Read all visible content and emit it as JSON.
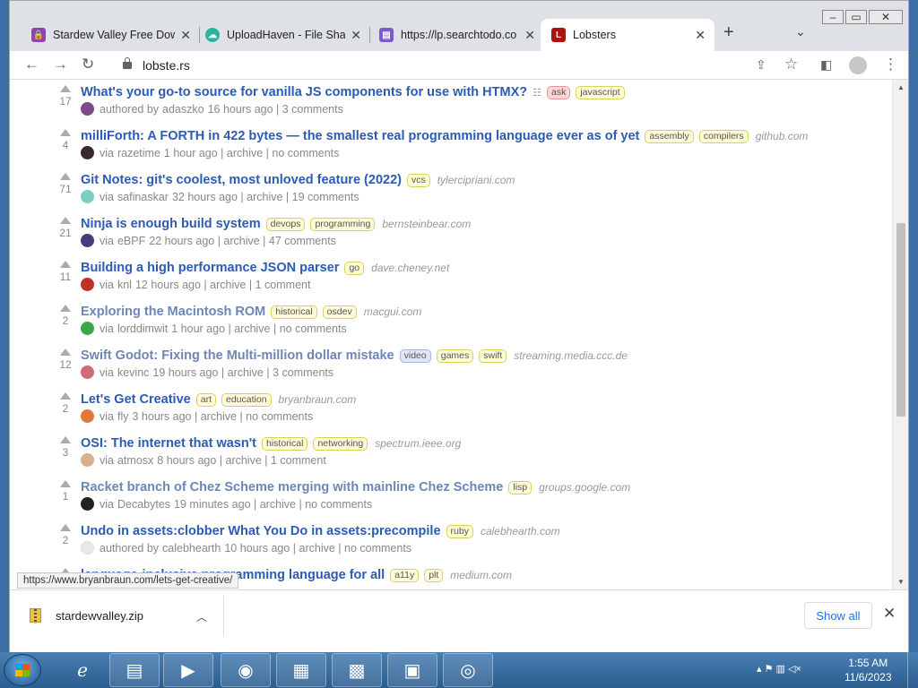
{
  "browser": {
    "tabs": [
      {
        "label": "Stardew Valley Free Dow",
        "active": false,
        "favicon_color": "#8e44ad"
      },
      {
        "label": "UploadHaven - File Shar",
        "active": false,
        "favicon_color": "#2bb39b"
      },
      {
        "label": "https://lp.searchtodo.co",
        "active": false,
        "favicon_color": "#7b5cc4"
      },
      {
        "label": "Lobsters",
        "active": true,
        "favicon_color": "#ac130d"
      }
    ],
    "favicon_letter": "L",
    "new_tab": "+",
    "address": "lobste.rs"
  },
  "stories": [
    {
      "title": "What's your go-to source for vanilla JS components for use with HTMX?",
      "score": "17",
      "tags": [
        "ask",
        "javascript"
      ],
      "domain": "",
      "byline": "authored by",
      "user": "adaszko",
      "meta": "16 hours ago | 3 comments",
      "visited": false,
      "avatar_color": "#7b4a8a"
    },
    {
      "title": "milliForth: A FORTH in 422 bytes — the smallest real programming language ever as of yet",
      "score": "4",
      "tags": [
        "assembly",
        "compilers"
      ],
      "domain": "github.com",
      "byline": "via",
      "user": "razetime",
      "meta": "1 hour ago | archive | no comments",
      "visited": false,
      "avatar_color": "#3a2a2a"
    },
    {
      "title": "Git Notes: git's coolest, most unloved feature (2022)",
      "score": "71",
      "tags": [
        "vcs"
      ],
      "domain": "tylercipriani.com",
      "byline": "via",
      "user": "safinaskar",
      "meta": "32 hours ago | archive | 19 comments",
      "visited": false,
      "avatar_color": "#7fcfc0"
    },
    {
      "title": "Ninja is enough build system",
      "score": "21",
      "tags": [
        "devops",
        "programming"
      ],
      "domain": "bernsteinbear.com",
      "byline": "via",
      "user": "eBPF",
      "meta": "22 hours ago | archive | 47 comments",
      "visited": false,
      "avatar_color": "#4a3a7a"
    },
    {
      "title": "Building a high performance JSON parser",
      "score": "11",
      "tags": [
        "go"
      ],
      "domain": "dave.cheney.net",
      "byline": "via",
      "user": "knl",
      "meta": "12 hours ago | archive | 1 comment",
      "visited": false,
      "avatar_color": "#c0302a"
    },
    {
      "title": "Exploring the Macintosh ROM",
      "score": "2",
      "tags": [
        "historical",
        "osdev"
      ],
      "domain": "macgui.com",
      "byline": "via",
      "user": "lorddimwit",
      "meta": "1 hour ago | archive | no comments",
      "visited": true,
      "avatar_color": "#3aa84a"
    },
    {
      "title": "Swift Godot: Fixing the Multi-million dollar mistake",
      "score": "12",
      "tags": [
        "video",
        "games",
        "swift"
      ],
      "domain": "streaming.media.ccc.de",
      "byline": "via",
      "user": "kevinc",
      "meta": "19 hours ago | archive | 3 comments",
      "visited": true,
      "avatar_color": "#d06a7a"
    },
    {
      "title": "Let's Get Creative",
      "score": "2",
      "tags": [
        "art",
        "education"
      ],
      "domain": "bryanbraun.com",
      "byline": "via",
      "user": "fly",
      "meta": "3 hours ago | archive | no comments",
      "visited": false,
      "avatar_color": "#e07a3a"
    },
    {
      "title": "OSI: The internet that wasn't",
      "score": "3",
      "tags": [
        "historical",
        "networking"
      ],
      "domain": "spectrum.ieee.org",
      "byline": "via",
      "user": "atmosx",
      "meta": "8 hours ago | archive | 1 comment",
      "visited": false,
      "avatar_color": "#d9b08a"
    },
    {
      "title": "Racket branch of Chez Scheme merging with mainline Chez Scheme",
      "score": "1",
      "tags": [
        "lisp"
      ],
      "domain": "groups.google.com",
      "byline": "via",
      "user": "Decabytes",
      "meta": "19 minutes ago | archive | no comments",
      "visited": true,
      "avatar_color": "#222222"
    },
    {
      "title": "Undo in assets:clobber What You Do in assets:precompile",
      "score": "2",
      "tags": [
        "ruby"
      ],
      "domain": "calebhearth.com",
      "byline": "authored by",
      "user": "calebhearth",
      "meta": "10 hours ago | archive | no comments",
      "visited": false,
      "avatar_color": "#e8e8e8"
    },
    {
      "title": "language-inclusive programming language for all",
      "score": "",
      "tags": [
        "a11y",
        "plt"
      ],
      "domain": "medium.com",
      "byline": "",
      "user": "",
      "meta": "",
      "visited": false,
      "avatar_color": "#ffffff"
    }
  ],
  "status_url": "https://www.bryanbraun.com/lets-get-creative/",
  "downloads": {
    "file": "stardewvalley.zip",
    "show_all": "Show all"
  },
  "taskbar": {
    "time": "1:55 AM",
    "date": "11/6/2023"
  }
}
